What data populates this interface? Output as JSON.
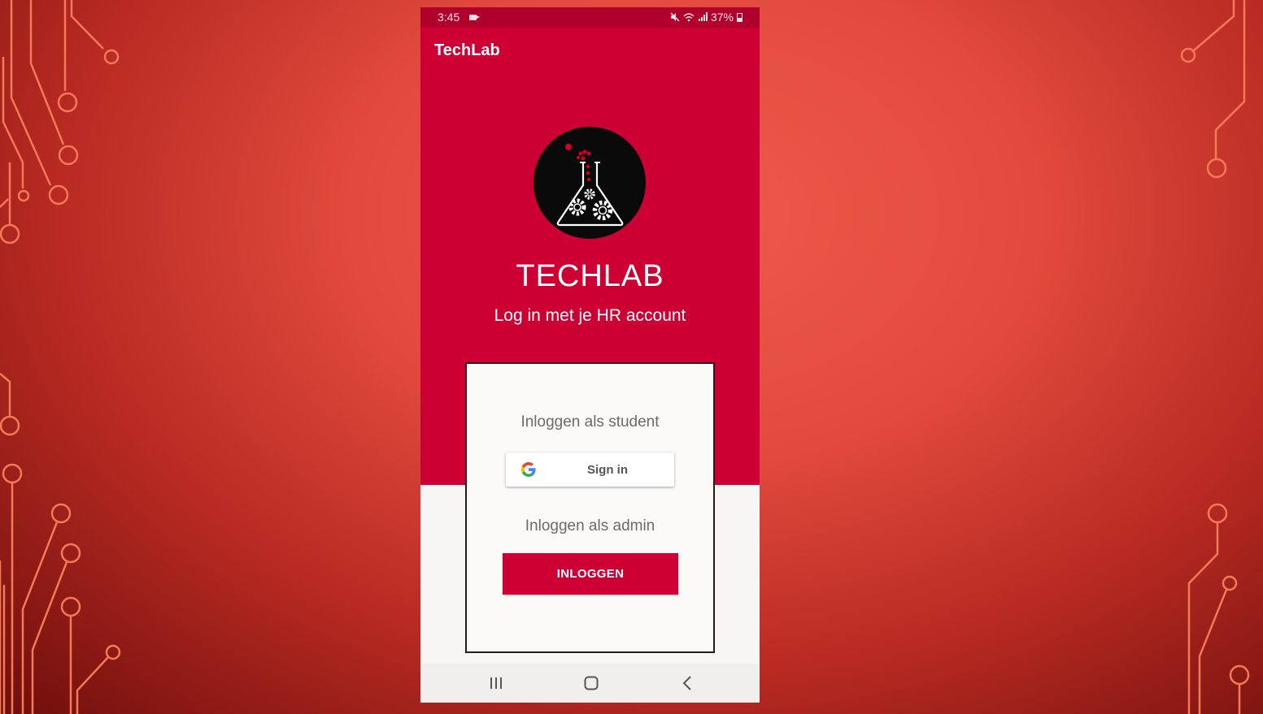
{
  "status_bar": {
    "time": "3:45",
    "battery": "37%",
    "icons": [
      "video-camera-icon",
      "mute-icon",
      "wifi-icon",
      "signal-icon",
      "battery-icon"
    ]
  },
  "app_bar": {
    "title": "TechLab"
  },
  "hero": {
    "brand": "TECHLAB",
    "subtitle": "Log in met je HR account",
    "logo_icon": "flask-gears-icon"
  },
  "login_card": {
    "student_label": "Inloggen als student",
    "google_button_label": "Sign in",
    "admin_label": "Inloggen als admin",
    "admin_button_label": "INLOGGEN"
  },
  "nav_bar": {
    "icons": [
      "recents-icon",
      "home-icon",
      "back-icon"
    ]
  },
  "colors": {
    "primary": "#ce0033",
    "status_bar": "#b0002c",
    "card_background": "#fbfaf8",
    "slide_background": "#e24a3d"
  }
}
